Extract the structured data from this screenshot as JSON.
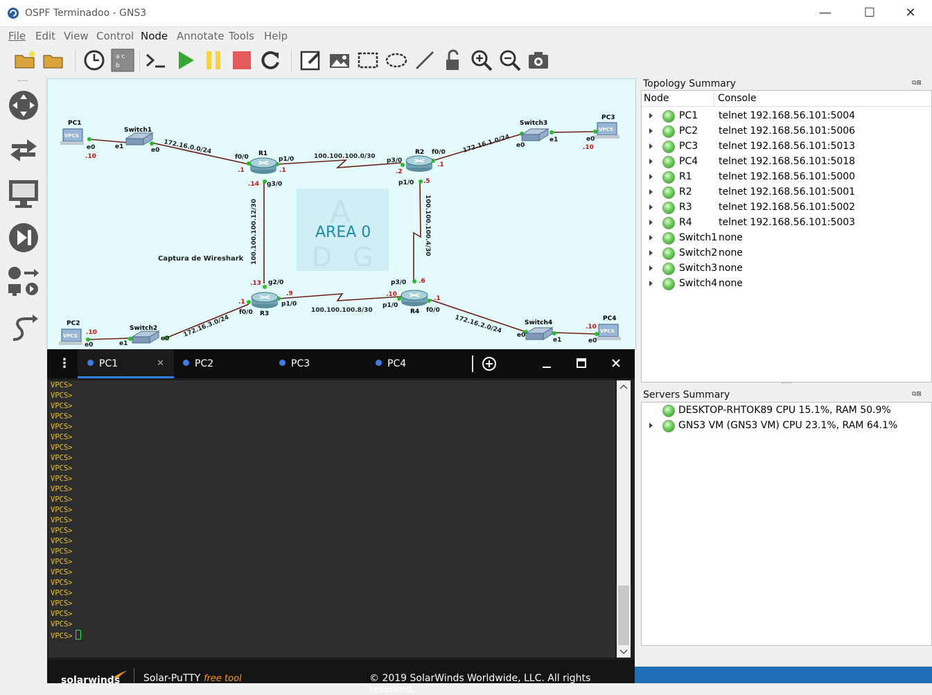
{
  "window": {
    "title": "OSPF Terminadoo - GNS3",
    "minimize": "—",
    "maximize": "☐",
    "close": "✕"
  },
  "menu": [
    "File",
    "Edit",
    "View",
    "Control",
    "Node",
    "Annotate",
    "Tools",
    "Help"
  ],
  "toolbar": [
    "open-project",
    "open-folder",
    "snapshot-clock",
    "show-labels",
    "console-all",
    "start-all",
    "suspend-all",
    "stop-all",
    "reload-all",
    "add-note",
    "insert-picture",
    "draw-rectangle",
    "draw-ellipse",
    "draw-line",
    "lock",
    "zoom-in",
    "zoom-out",
    "screenshot"
  ],
  "canvas": {
    "area_label": "AREA 0",
    "area_watermark": [
      "A",
      "D",
      "G"
    ],
    "wireshark_label": "Captura de Wireshark",
    "nodes": {
      "pc1": "PC1",
      "pc2": "PC2",
      "pc3": "PC3",
      "pc4": "PC4",
      "sw1": "Switch1",
      "sw2": "Switch2",
      "sw3": "Switch3",
      "sw4": "Switch4",
      "r1": "R1",
      "r2": "R2",
      "r3": "R3",
      "r4": "R4",
      "vpcs": "VPCS"
    },
    "links": {
      "net_sw1_r1": "172.16.0.0/24",
      "net_r1_r2": "100.100.100.0/30",
      "net_r2_sw3": "172.16.1.0/24",
      "net_r1_r3": "100.100.100.12/30",
      "net_r2_r4": "100.100.100.4/30",
      "net_r3_r4": "100.100.100.8/30",
      "net_sw2_r3": "172.16.3.0/24",
      "net_r4_sw4": "172.16.2.0/24"
    },
    "ports": {
      "pc1_e0": "e0",
      "pc1_ip": ".10",
      "sw1_e1": "e1",
      "sw1_e0": "e0",
      "r1_f00": "f0/0",
      "r1_f00_ip": ".1",
      "r1_p10": "p1/0",
      "r1_p10_ip": ".1",
      "r1_g30": "g3/0",
      "r1_g30_ip": ".14",
      "r2_p30": "p3/0",
      "r2_p30_ip": ".2",
      "r2_f00": "f0/0",
      "r2_f00_ip": ".1",
      "r2_p10": "p1/0",
      "r2_p10_ip": ".5",
      "sw3_e0": "e0",
      "sw3_e1": "e1",
      "pc3_e0": "e0",
      "pc3_ip": ".10",
      "r3_g20": "g2/0",
      "r3_g20_ip": ".13",
      "r3_p10": "p1/0",
      "r3_p10_ip": ".9",
      "r3_f00": "f0/0",
      "r3_f00_ip": ".1",
      "r4_p30": "p3/0",
      "r4_p30_ip": ".6",
      "r4_p10": "p1/0",
      "r4_p10_ip": ".10",
      "r4_f00": "f0/0",
      "r4_f00_ip": ".1",
      "pc2_e0": "e0",
      "pc2_ip": ".10",
      "sw2_e1": "e1",
      "sw2_e0": "e0",
      "sw4_e0": "e0",
      "sw4_e1": "e1",
      "pc4_e0": "e0",
      "pc4_ip": ".10"
    }
  },
  "terminal": {
    "tabs": [
      "PC1",
      "PC2",
      "PC3",
      "PC4"
    ],
    "active_tab": "PC1",
    "tab_close": "✕",
    "prompt": "VPCS>",
    "prompt_count": 25,
    "footer_brand": "solarwinds",
    "footer_app": "Solar-PuTTY",
    "footer_free": "free tool",
    "footer_copyright": "© 2019 SolarWinds Worldwide, LLC. All rights reserved."
  },
  "topology_summary": {
    "title": "Topology Summary",
    "col_node": "Node",
    "col_console": "Console",
    "rows": [
      {
        "node": "PC1",
        "console": "telnet 192.168.56.101:5004"
      },
      {
        "node": "PC2",
        "console": "telnet 192.168.56.101:5006"
      },
      {
        "node": "PC3",
        "console": "telnet 192.168.56.101:5013"
      },
      {
        "node": "PC4",
        "console": "telnet 192.168.56.101:5018"
      },
      {
        "node": "R1",
        "console": "telnet 192.168.56.101:5000"
      },
      {
        "node": "R2",
        "console": "telnet 192.168.56.101:5001"
      },
      {
        "node": "R3",
        "console": "telnet 192.168.56.101:5002"
      },
      {
        "node": "R4",
        "console": "telnet 192.168.56.101:5003"
      },
      {
        "node": "Switch1",
        "console": "none"
      },
      {
        "node": "Switch2",
        "console": "none"
      },
      {
        "node": "Switch3",
        "console": "none"
      },
      {
        "node": "Switch4",
        "console": "none"
      }
    ]
  },
  "servers_summary": {
    "title": "Servers Summary",
    "rows": [
      {
        "text": "DESKTOP-RHTOK89 CPU 15.1%, RAM 50.9%"
      },
      {
        "text": "GNS3 VM (GNS3 VM) CPU 23.1%, RAM 64.1%"
      }
    ]
  },
  "colors": {
    "accent": "#2f7fe0",
    "prompt": "#e8c12b",
    "link": "#6b1f14",
    "port_ip": "#d01010",
    "green_dot": "#26c026"
  }
}
